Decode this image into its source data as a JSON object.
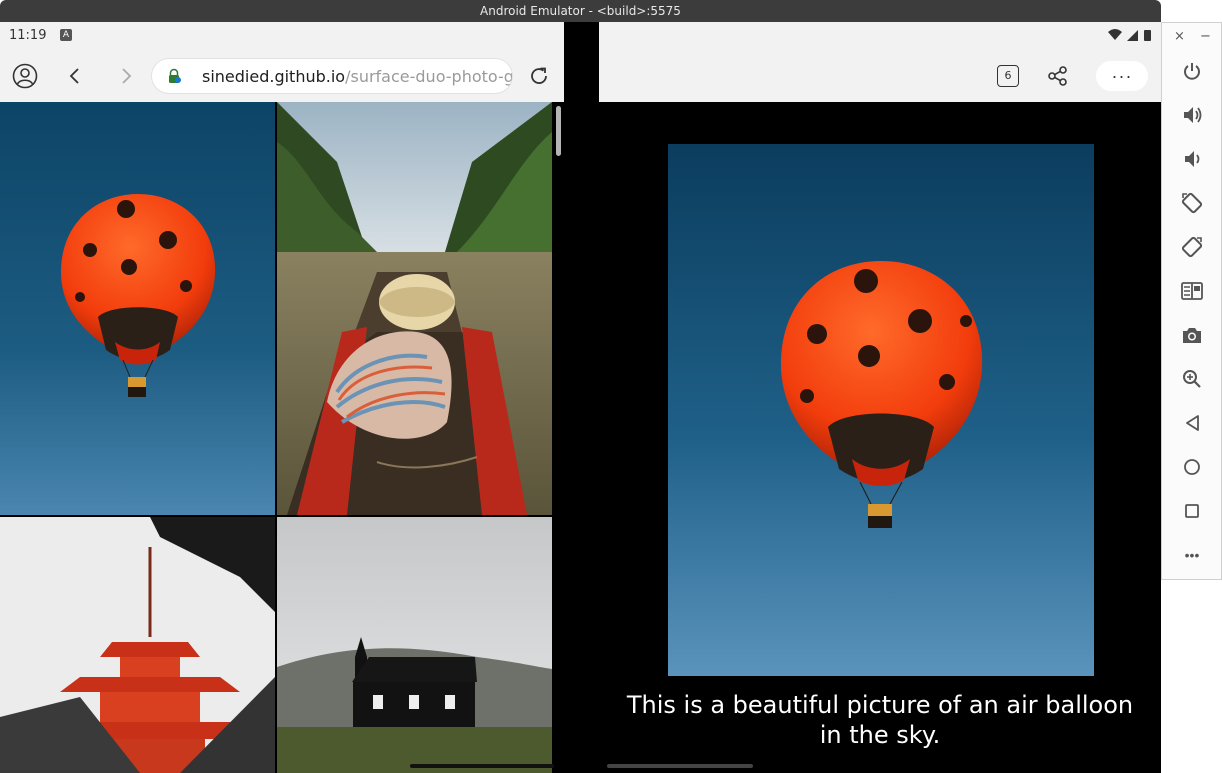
{
  "window": {
    "title": "Android Emulator - <build>:5575"
  },
  "left_status": {
    "time": "11:19",
    "notification_badge": "A"
  },
  "browser": {
    "url_host": "sinedied.github.io",
    "url_path": "/surface-duo-photo-galle"
  },
  "gallery": {
    "tiles": [
      "air-balloon",
      "boat-woman",
      "red-pagoda",
      "black-church"
    ]
  },
  "detail": {
    "tab_count": "6",
    "more_label": "···",
    "caption": "This is a beautiful picture of an air balloon in the sky."
  },
  "emulator_panel": {
    "close_label": "×",
    "minimize_label": "−",
    "buttons": [
      "power-icon",
      "volume-up-icon",
      "volume-down-icon",
      "rotate-left-icon",
      "rotate-right-icon",
      "fold-icon",
      "camera-icon",
      "zoom-icon",
      "back-icon",
      "home-icon",
      "overview-icon",
      "more-icon"
    ],
    "more_label": "•••"
  },
  "colors": {
    "balloon_red": "#ff4a14",
    "sky_blue": "#1d5c82",
    "panel_bg": "#fbfbfb",
    "toolbar_bg": "#f2f2f2"
  }
}
